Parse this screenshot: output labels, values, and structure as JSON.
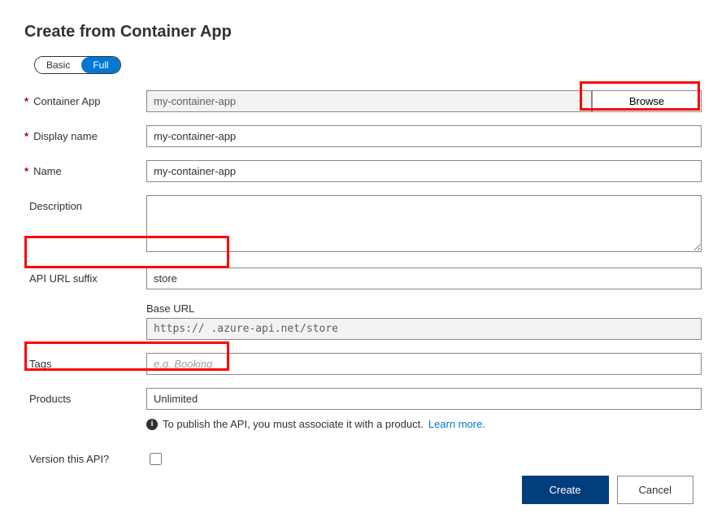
{
  "title": "Create from Container App",
  "toggle": {
    "basic": "Basic",
    "full": "Full"
  },
  "containerApp": {
    "label": "Container App",
    "value": "my-container-app",
    "browse": "Browse"
  },
  "displayName": {
    "label": "Display name",
    "value": "my-container-app"
  },
  "name": {
    "label": "Name",
    "value": "my-container-app"
  },
  "description": {
    "label": "Description",
    "value": ""
  },
  "apiUrlSuffix": {
    "label": "API URL suffix",
    "value": "store"
  },
  "baseUrl": {
    "label": "Base URL",
    "value": "https://            .azure-api.net/store"
  },
  "tags": {
    "label": "Tags",
    "placeholder": "e.g. Booking",
    "value": ""
  },
  "products": {
    "label": "Products",
    "value": "Unlimited"
  },
  "infoNote": {
    "text": "To publish the API, you must associate it with a product.",
    "link": "Learn more."
  },
  "versionApi": {
    "label": "Version this API?"
  },
  "buttons": {
    "create": "Create",
    "cancel": "Cancel"
  }
}
